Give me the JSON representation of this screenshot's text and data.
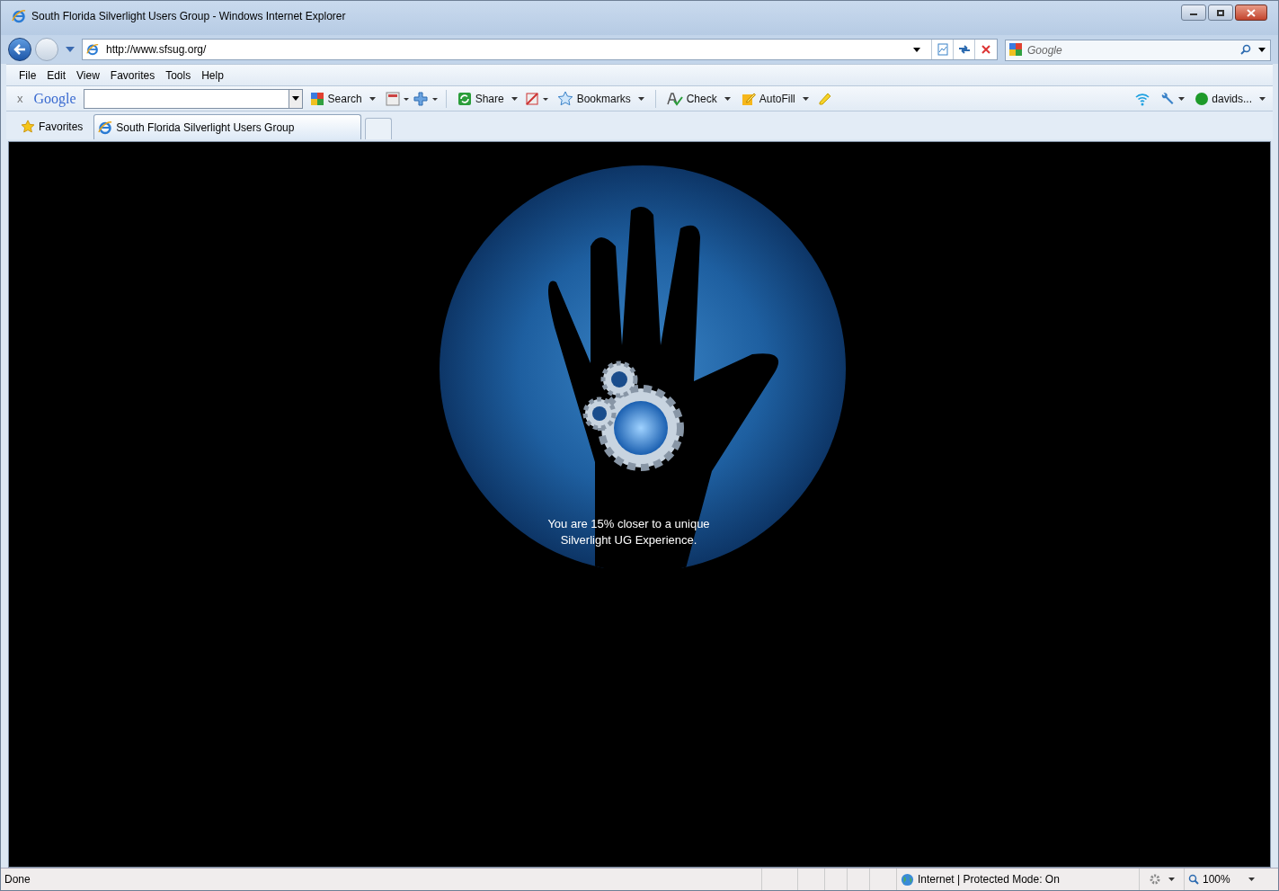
{
  "window": {
    "title": "South Florida Silverlight Users Group - Windows Internet Explorer"
  },
  "address_bar": {
    "url": "http://www.sfsug.org/"
  },
  "search_box": {
    "placeholder": "Google"
  },
  "menu": [
    "File",
    "Edit",
    "View",
    "Favorites",
    "Tools",
    "Help"
  ],
  "google_toolbar": {
    "close": "x",
    "logo": "Google",
    "buttons": [
      {
        "kind": "search",
        "label": "Search"
      },
      {
        "kind": "share",
        "label": "Share"
      },
      {
        "kind": "bookmarks",
        "label": "Bookmarks"
      },
      {
        "kind": "check",
        "label": "Check"
      },
      {
        "kind": "autofill",
        "label": "AutoFill"
      }
    ],
    "account": "davids..."
  },
  "favorites": {
    "label": "Favorites"
  },
  "tabs": [
    {
      "label": "South Florida Silverlight Users Group",
      "selected": true
    }
  ],
  "page": {
    "message": "You are 15% closer to a unique Silverlight UG Experience."
  },
  "status_bar": {
    "status": "Done",
    "zone": "Internet | Protected Mode: On",
    "zoom": "100%"
  }
}
